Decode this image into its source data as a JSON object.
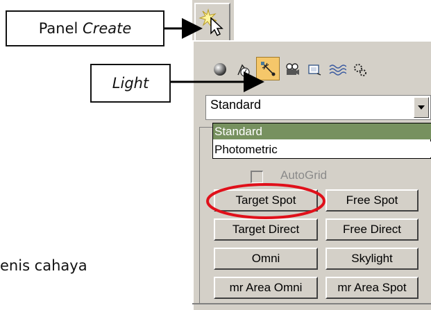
{
  "callouts": {
    "panel_create_prefix": "Panel ",
    "panel_create_italic": "Create",
    "light": "Light"
  },
  "stray_text": "enis cahaya",
  "dropdown": {
    "selected_value": "Standard",
    "options": [
      "Standard",
      "Photometric"
    ]
  },
  "autogrid_label": "AutoGrid",
  "buttons": {
    "target_spot": "Target Spot",
    "free_spot": "Free Spot",
    "target_direct": "Target Direct",
    "free_direct": "Free Direct",
    "omni": "Omni",
    "skylight": "Skylight",
    "mr_area_omni": "mr Area Omni",
    "mr_area_spot": "mr Area Spot"
  },
  "icons": [
    "create-tab-icon",
    "geometry-icon",
    "shapes-icon",
    "lights-icon",
    "cameras-icon",
    "helpers-icon",
    "space-warps-icon",
    "systems-icon"
  ],
  "colors": {
    "panel_bg": "#d4d0c8",
    "active_icon_bg": "#f5c76a",
    "highlight_row": "#77915f",
    "highlight_circle": "#e0101a"
  }
}
